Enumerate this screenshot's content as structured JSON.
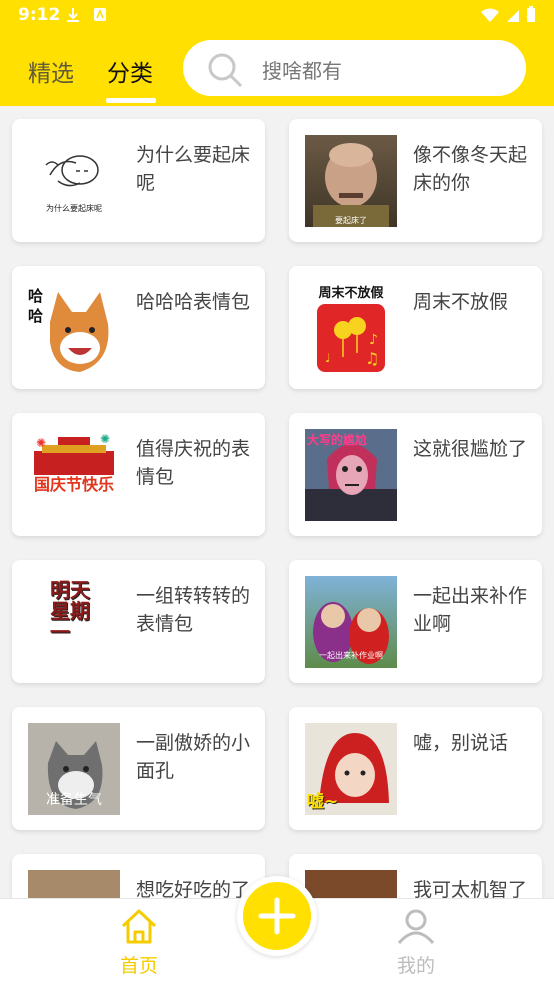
{
  "status_bar": {
    "time": "9:12"
  },
  "header": {
    "tabs": [
      {
        "label": "精选",
        "active": false
      },
      {
        "label": "分类",
        "active": true
      }
    ],
    "search": {
      "placeholder": "搜啥都有"
    }
  },
  "categories": [
    {
      "title": "为什么要起床呢",
      "thumb_caption": "为什么要起床呢"
    },
    {
      "title": "像不像冬天起床的你",
      "thumb_caption": "要起床了"
    },
    {
      "title": "哈哈哈表情包",
      "thumb_caption": "哈哈"
    },
    {
      "title": "周末不放假",
      "thumb_caption": "周末不放假"
    },
    {
      "title": "值得庆祝的表情包",
      "thumb_caption": "国庆节快乐"
    },
    {
      "title": "这就很尴尬了",
      "thumb_caption": "大写的尴尬"
    },
    {
      "title": "一组转转转的表情包",
      "thumb_caption": "明天星期一"
    },
    {
      "title": "一起出来补作业啊",
      "thumb_caption": "一起出来补作业啊"
    },
    {
      "title": "一副傲娇的小面孔",
      "thumb_caption": "准备生气"
    },
    {
      "title": "嘘，别说话",
      "thumb_caption": "嘘~"
    },
    {
      "title": "想吃好吃的了",
      "thumb_caption": ""
    },
    {
      "title": "我可太机智了",
      "thumb_caption": ""
    }
  ],
  "bottom_nav": {
    "home_label": "首页",
    "mine_label": "我的"
  },
  "colors": {
    "brand_yellow": "#ffe000",
    "active_nav": "#f4cc00",
    "inactive_nav": "#bdbdbd"
  }
}
